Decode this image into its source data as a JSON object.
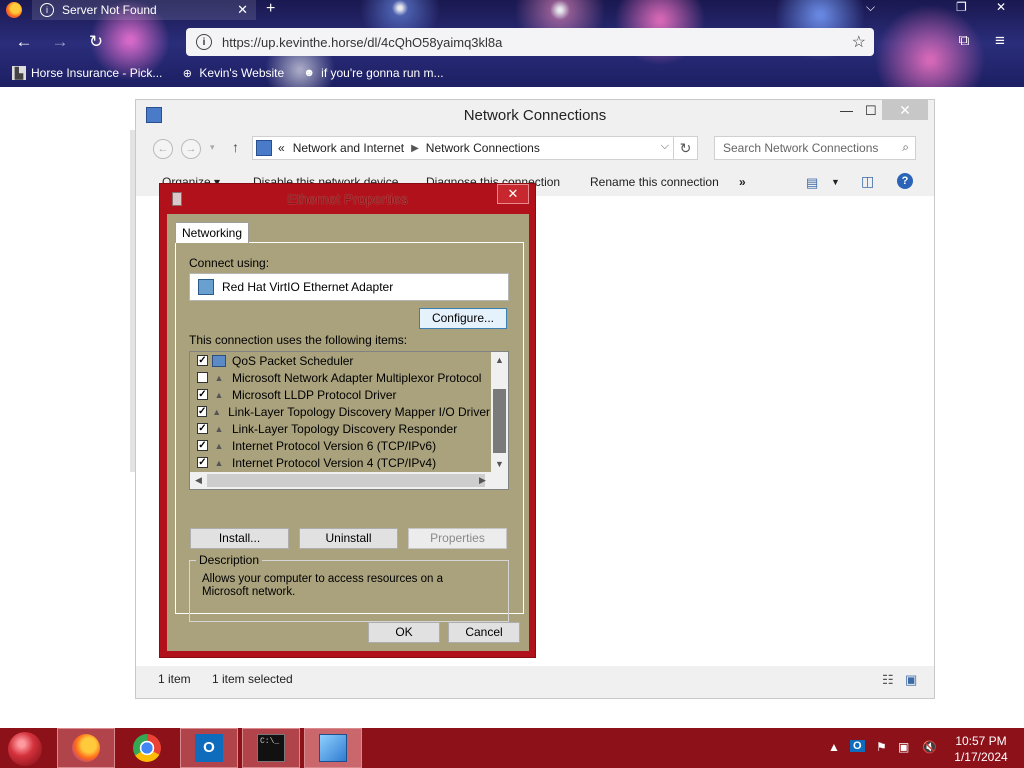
{
  "browser": {
    "tab_title": "Server Not Found",
    "url": "https://up.kevinthe.horse/dl/4cQhO58yaimq3kl8a",
    "bookmarks": [
      {
        "label": "Horse Insurance - Pick..."
      },
      {
        "label": "Kevin's Website"
      },
      {
        "label": "if you're gonna run m..."
      }
    ]
  },
  "nc_window": {
    "title": "Network Connections",
    "breadcrumb": [
      "Network and Internet",
      "Network Connections"
    ],
    "breadcrumb_prefix": "«",
    "search_placeholder": "Search Network Connections",
    "toolbar": {
      "organize": "Organize ▾",
      "disable": "Disable this network device",
      "diagnose": "Diagnose this connection",
      "rename": "Rename this connection",
      "more": "»"
    },
    "status": {
      "items": "1 item",
      "selected": "1 item selected"
    }
  },
  "dialog": {
    "title": "Ethernet Properties",
    "tab": "Networking",
    "connect_using_label": "Connect using:",
    "adapter": "Red Hat VirtIO Ethernet Adapter",
    "configure_button": "Configure...",
    "items_label": "This connection uses the following items:",
    "items": [
      {
        "label": "QoS Packet Scheduler",
        "checked": true
      },
      {
        "label": "Microsoft Network Adapter Multiplexor Protocol",
        "checked": false
      },
      {
        "label": "Microsoft LLDP Protocol Driver",
        "checked": true
      },
      {
        "label": "Link-Layer Topology Discovery Mapper I/O Driver",
        "checked": true
      },
      {
        "label": "Link-Layer Topology Discovery Responder",
        "checked": true
      },
      {
        "label": "Internet Protocol Version 6 (TCP/IPv6)",
        "checked": true
      },
      {
        "label": "Internet Protocol Version 4 (TCP/IPv4)",
        "checked": true
      }
    ],
    "install_button": "Install...",
    "uninstall_button": "Uninstall",
    "properties_button": "Properties",
    "description_legend": "Description",
    "description_text": "Allows your computer to access resources on a Microsoft network.",
    "ok_button": "OK",
    "cancel_button": "Cancel"
  },
  "taskbar": {
    "time": "10:57 PM",
    "date": "1/17/2024",
    "apps": [
      "firefox",
      "chrome",
      "outlook",
      "command-prompt",
      "control-panel"
    ]
  },
  "colors": {
    "dialog_frame": "#b0111b",
    "dialog_body": "#a9a27d",
    "taskbar": "#8c1118",
    "browser_bg": "#1d1f63"
  }
}
